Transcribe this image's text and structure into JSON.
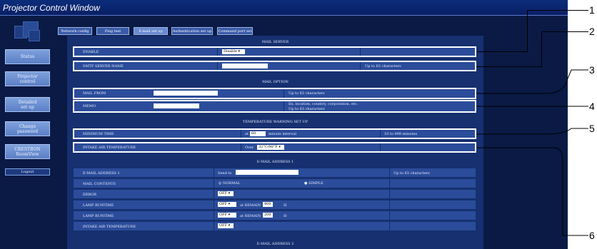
{
  "window": {
    "title": "Projector Control Window"
  },
  "sidebar": {
    "items": [
      {
        "label": "Status"
      },
      {
        "label": "Projector\ncontrol"
      },
      {
        "label": "Detailed\nset up"
      },
      {
        "label": "Change\npassword"
      },
      {
        "label": "CRESTRON\nRoomView"
      }
    ],
    "logout_label": "Logout"
  },
  "tabs": [
    {
      "label": "Network config"
    },
    {
      "label": "Ping test"
    },
    {
      "label": "E-mail set up"
    },
    {
      "label": "Authentication set up"
    },
    {
      "label": "Command port set up"
    }
  ],
  "mail_server": {
    "section_title": "MAIL SERVER",
    "enable_label": "ENABLE",
    "enable_value": "Disable",
    "smtp_label": "SMTP SERVER NAME",
    "smtp_hint": "Up to 63 characters"
  },
  "mail_option": {
    "section_title": "MAIL OPTION",
    "mail_from_label": "MAIL FROM",
    "mail_from_hint": "Up to 63 characters",
    "memo_label": "MEMO",
    "memo_hint_1": "Ex. location, country, corporation, etc.",
    "memo_hint_2": "Up to 63 characters"
  },
  "temperature": {
    "section_title": "TEMPERATURE WARNING SET UP",
    "minimum_time_label": "MINIMUM TIME",
    "minimum_time_prefix": "at",
    "minimum_time_value": "60",
    "minimum_time_suffix": "minute interval",
    "minimum_time_hint": "10 to 999 minutes",
    "intake_label": "INTAKE AIR TEMPERATURE",
    "intake_prefix": "Over",
    "intake_value": "32°C/90°F"
  },
  "email1": {
    "section_title": "E-MAIL ADDRESS 1",
    "address_label": "E-MAIL ADDRESS 1",
    "address_prefix": "Send to",
    "address_hint": "Up to 63 characters",
    "contents_label": "MAIL CONTENTS",
    "normal_label": "NORMAL",
    "simple_label": "SIMPLE",
    "error_label": "ERROR",
    "error_value": "OFF",
    "lamp1_label": "LAMP RUNTIME",
    "lamp1_value": "OFF",
    "lamp1_remain": "at REMAIN",
    "lamp1_hours": "400",
    "lamp1_unit": "H",
    "lamp2_label": "LAMP RUNTIME",
    "lamp2_value": "OFF",
    "lamp2_remain": "at REMAIN",
    "lamp2_hours": "200",
    "lamp2_unit": "H",
    "intake_label": "INTAKE AIR TEMPERATURE",
    "intake_value": "OFF"
  },
  "email2": {
    "section_title": "E-MAIL ADDRESS 2"
  },
  "callouts": [
    "1",
    "2",
    "3",
    "4",
    "5",
    "6"
  ]
}
